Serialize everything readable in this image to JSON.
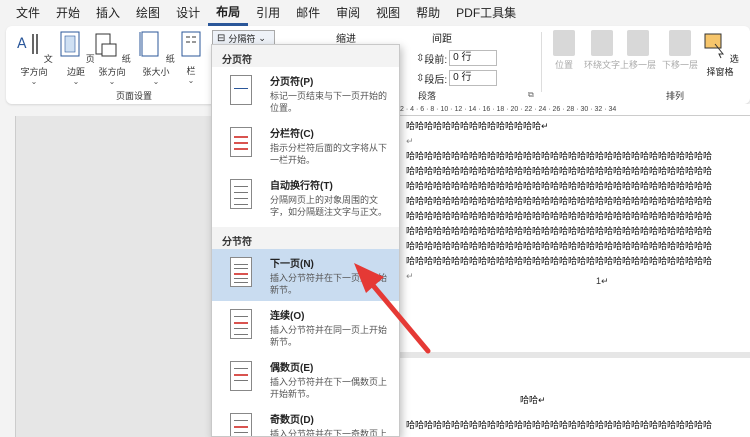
{
  "menubar": {
    "tabs": [
      "文件",
      "开始",
      "插入",
      "绘图",
      "设计",
      "布局",
      "引用",
      "邮件",
      "审阅",
      "视图",
      "帮助",
      "PDF工具集"
    ],
    "active": "布局"
  },
  "ribbon": {
    "page_setup": {
      "buttons": [
        "文字方向",
        "页边距",
        "纸张方向",
        "纸张大小",
        "栏"
      ],
      "label": "页面设置"
    },
    "breaks_label": "分隔符",
    "indent_label": "缩进",
    "spacing_label": "间距",
    "spacing_before_label": "段前:",
    "spacing_before_value": "0 行",
    "spacing_after_label": "段后:",
    "spacing_after_value": "0 行",
    "paragraph_label": "段落",
    "arrange": {
      "buttons": [
        "位置",
        "环绕文字",
        "上移一层",
        "下移一层",
        "选择窗格"
      ],
      "label": "排列"
    }
  },
  "dropdown": {
    "page_breaks_header": "分页符",
    "section_breaks_header": "分节符",
    "page_items": [
      {
        "title": "分页符(P)",
        "desc": "标记一页结束与下一页开始的位置。"
      },
      {
        "title": "分栏符(C)",
        "desc": "指示分栏符后面的文字将从下一栏开始。"
      },
      {
        "title": "自动换行符(T)",
        "desc": "分隔网页上的对象周围的文字，如分隔题注文字与正文。"
      }
    ],
    "section_items": [
      {
        "title": "下一页(N)",
        "desc": "插入分节符并在下一页上开始新节。"
      },
      {
        "title": "连续(O)",
        "desc": "插入分节符并在同一页上开始新节。"
      },
      {
        "title": "偶数页(E)",
        "desc": "插入分节符并在下一偶数页上开始新节。"
      },
      {
        "title": "奇数页(D)",
        "desc": "插入分节符并在下一奇数页上开始新节。"
      }
    ]
  },
  "document": {
    "first_line": "哈哈哈哈哈哈哈哈哈哈哈哈哈哈哈↵",
    "body_line": "哈哈哈哈哈哈哈哈哈哈哈哈哈哈哈哈哈哈哈哈哈哈哈哈哈哈哈哈哈哈哈哈哈哈",
    "return_mark": "↵",
    "page_number": "1↵",
    "page2_line1": "哈哈↵",
    "page2_line2": "哈哈哈哈哈哈哈哈哈哈哈哈哈哈哈哈哈哈哈哈哈哈哈哈哈哈哈哈哈哈哈哈哈哈"
  },
  "ruler_text": "2 · 4 · 6 · 8 · 10 · 12 · 14 · 16 · 18 · 20 · 22 · 24 · 26 · 28 · 30 · 32 · 34"
}
